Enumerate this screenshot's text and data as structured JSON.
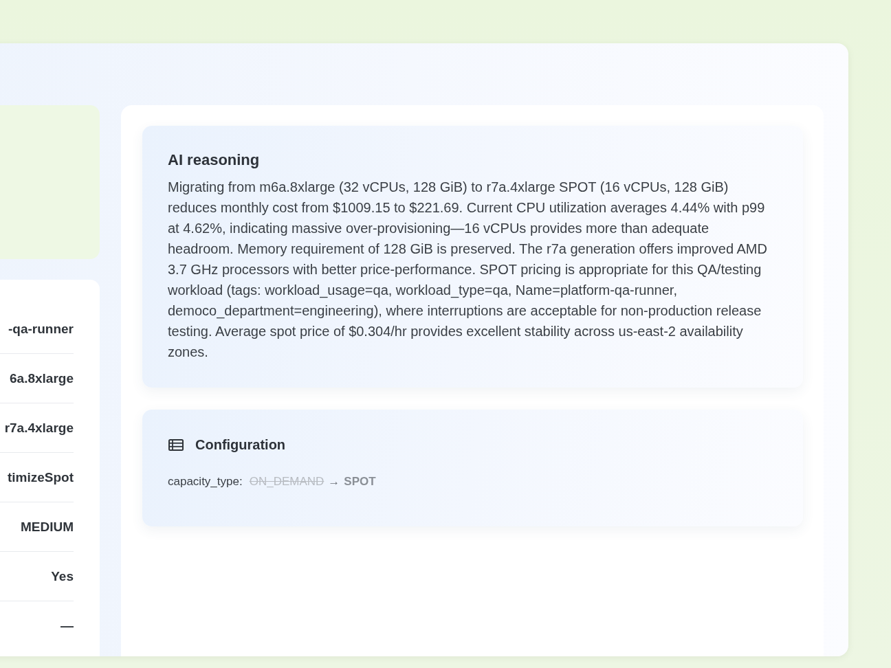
{
  "details": {
    "rows": [
      {
        "value": "-qa-runner"
      },
      {
        "value": "6a.8xlarge"
      },
      {
        "value": "r7a.4xlarge"
      },
      {
        "value": "timizeSpot"
      },
      {
        "value": "MEDIUM"
      },
      {
        "value": "Yes"
      },
      {
        "value": "—"
      }
    ]
  },
  "reasoning": {
    "title": "AI reasoning",
    "text": "Migrating from m6a.8xlarge (32 vCPUs, 128 GiB) to r7a.4xlarge SPOT (16 vCPUs, 128 GiB) reduces monthly cost from $1009.15 to $221.69. Current CPU utilization averages 4.44% with p99 at 4.62%, indicating massive over-provisioning—16 vCPUs provides more than adequate headroom. Memory requirement of 128 GiB is preserved. The r7a generation offers improved AMD 3.7 GHz processors with better price-performance. SPOT pricing is appropriate for this QA/testing workload (tags: workload_usage=qa, workload_type=qa, Name=platform-qa-runner, democo_department=engineering), where interruptions are acceptable for non-production release testing. Average spot price of $0.304/hr provides excellent stability across us-east-2 availability zones."
  },
  "configuration": {
    "title": "Configuration",
    "changes": [
      {
        "field": "capacity_type:",
        "from": "ON_DEMAND",
        "arrow": "→",
        "to": "SPOT"
      }
    ]
  }
}
